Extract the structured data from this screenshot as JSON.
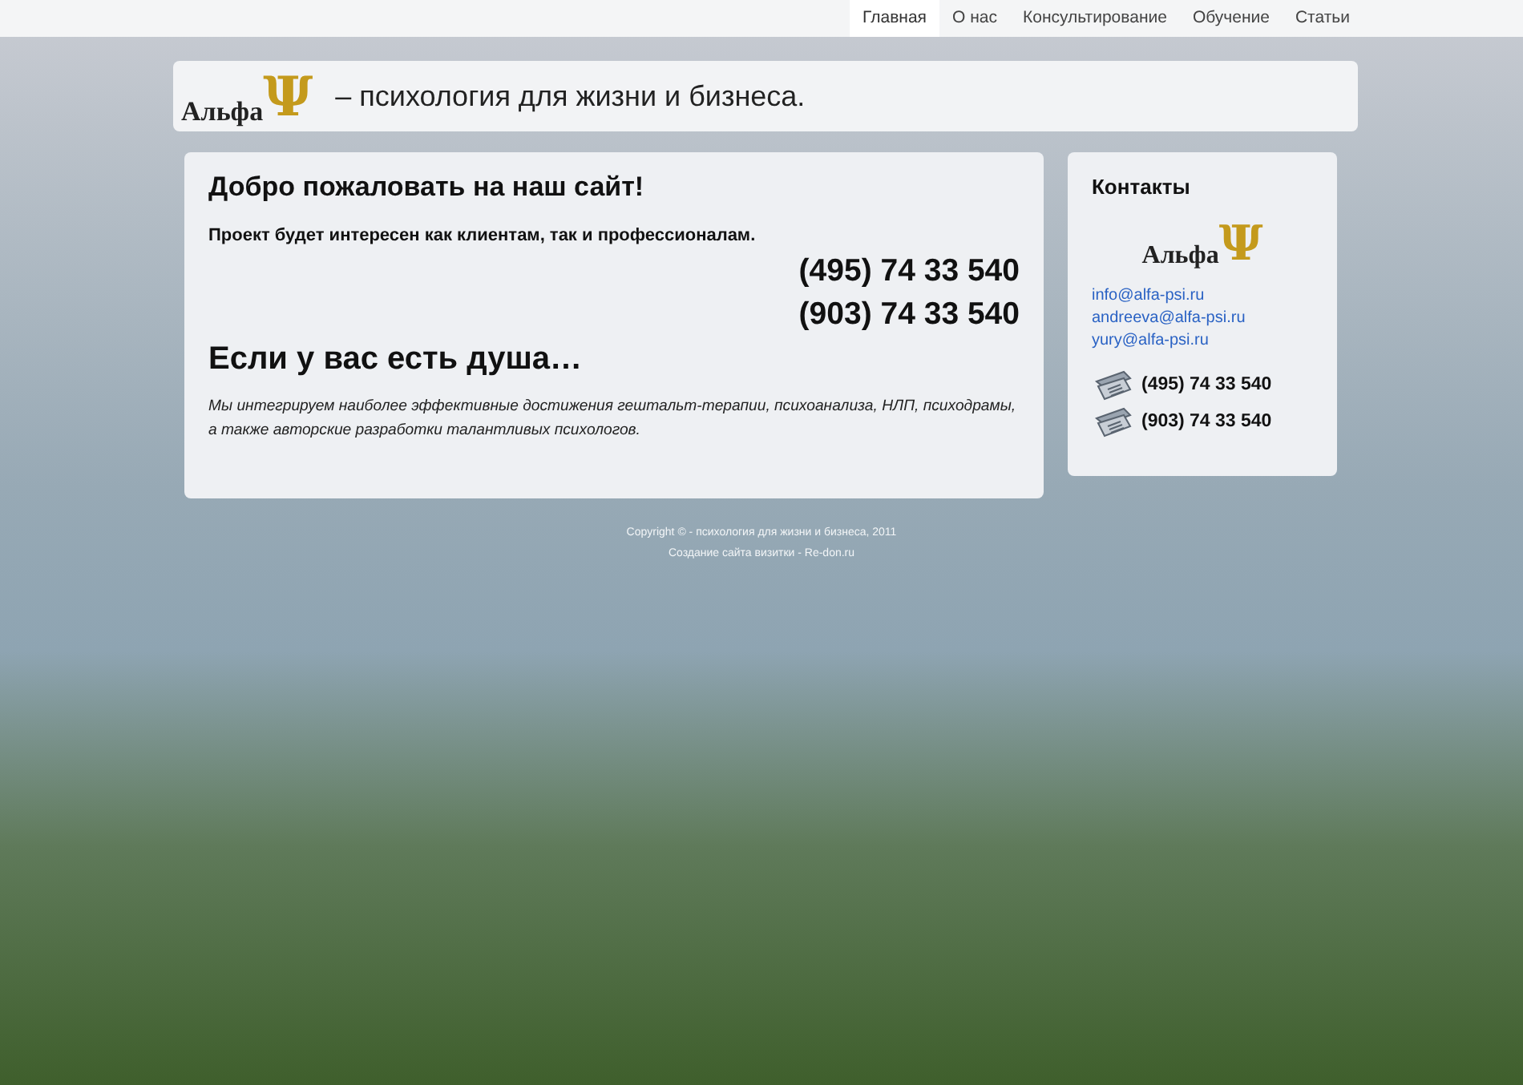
{
  "nav": [
    {
      "label": "Главная",
      "selected": true
    },
    {
      "label": "О нас",
      "selected": false
    },
    {
      "label": "Консультирование",
      "selected": false
    },
    {
      "label": "Обучение",
      "selected": false
    },
    {
      "label": "Статьи",
      "selected": false
    }
  ],
  "header": {
    "logo_word": "Альфа",
    "logo_symbol": "Ψ",
    "tagline": "– психология для жизни и бизнеса."
  },
  "main": {
    "title": "Добро пожаловать на наш сайт!",
    "intro": "Проект будет интересен как клиентам, так и профессионалам.",
    "phones": [
      "(495) 74 33 540",
      "(903) 74 33 540"
    ],
    "subtitle": "Если у вас есть душа…",
    "text": "Мы интегрируем наиболее эффективные достижения гештальт-терапии, психоанализа, НЛП, психодрамы, а также авторские разработки талантливых психологов."
  },
  "contacts": {
    "title": "Контакты",
    "logo_word": "Альфа",
    "logo_symbol": "Ψ",
    "emails": [
      "info@alfa-psi.ru",
      "andreeva@alfa-psi.ru",
      "yury@alfa-psi.ru"
    ],
    "phones": [
      "(495) 74 33 540",
      "(903) 74 33 540"
    ]
  },
  "footer": [
    "Copyright © - психология для жизни и бизнеса, 2011",
    "Создание сайта визитки - Re-don.ru"
  ]
}
